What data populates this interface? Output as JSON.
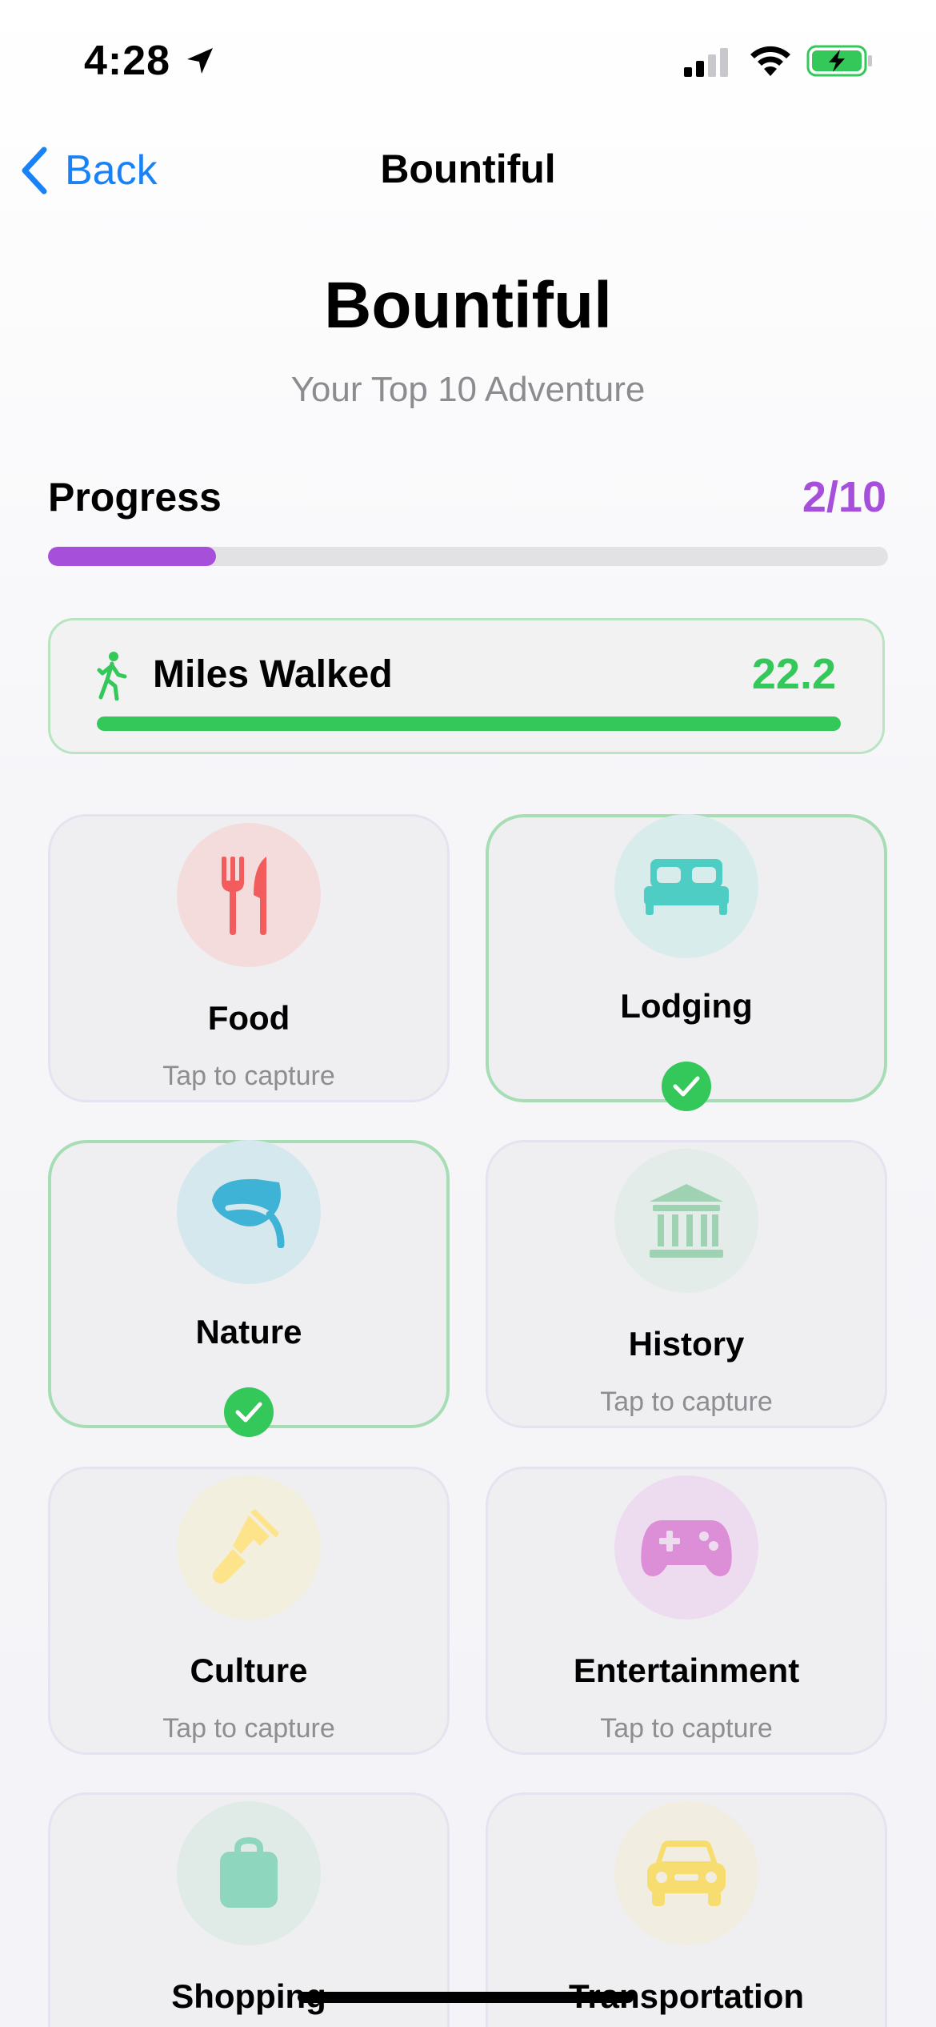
{
  "status": {
    "time": "4:28"
  },
  "nav": {
    "back_label": "Back",
    "title": "Bountiful"
  },
  "header": {
    "title": "Bountiful",
    "subtitle": "Your Top 10 Adventure"
  },
  "progress": {
    "label": "Progress",
    "count": "2/10",
    "completed": 2,
    "total": 10,
    "color": "#a64fdb"
  },
  "miles": {
    "label": "Miles Walked",
    "value": "22.2",
    "color": "#34c759",
    "fill_fraction": 1.0
  },
  "categories": [
    {
      "label": "Food",
      "subtitle": "Tap to capture",
      "icon": "fork-knife-icon",
      "color": "#f25c5c",
      "bg": "#f5dcdc",
      "captured": false
    },
    {
      "label": "Lodging",
      "subtitle": "",
      "icon": "bed-icon",
      "color": "#4ecdc4",
      "bg": "#d9ecec",
      "captured": true
    },
    {
      "label": "Nature",
      "subtitle": "",
      "icon": "leaf-icon",
      "color": "#3fb3d6",
      "bg": "#d5e8ee",
      "captured": true
    },
    {
      "label": "History",
      "subtitle": "Tap to capture",
      "icon": "museum-icon",
      "color": "#9fd2b3",
      "bg": "#e3ece8",
      "captured": false
    },
    {
      "label": "Culture",
      "subtitle": "Tap to capture",
      "icon": "paintbrush-icon",
      "color": "#fde38a",
      "bg": "#f3efdf",
      "captured": false
    },
    {
      "label": "Entertainment",
      "subtitle": "Tap to capture",
      "icon": "gamecontroller-icon",
      "color": "#dc8fd6",
      "bg": "#eddcef",
      "captured": false
    },
    {
      "label": "Shopping",
      "subtitle": "",
      "icon": "bag-icon",
      "color": "#8fd6bf",
      "bg": "#e0ebe7",
      "captured": false
    },
    {
      "label": "Transportation",
      "subtitle": "",
      "icon": "car-icon",
      "color": "#f7dc6f",
      "bg": "#f1ede0",
      "captured": false
    }
  ]
}
